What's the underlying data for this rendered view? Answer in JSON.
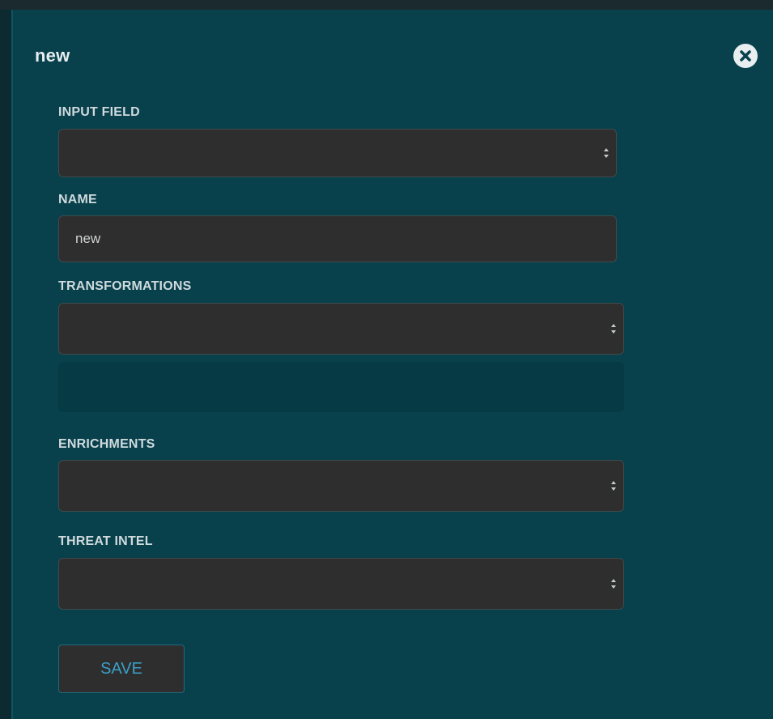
{
  "panel": {
    "title": "new",
    "close_icon": "close-circle-icon"
  },
  "form": {
    "input_field": {
      "label": "INPUT FIELD",
      "value": ""
    },
    "name": {
      "label": "NAME",
      "value": "new"
    },
    "transformations": {
      "label": "TRANSFORMATIONS",
      "value": ""
    },
    "enrichments": {
      "label": "ENRICHMENTS",
      "value": ""
    },
    "threat_intel": {
      "label": "THREAT INTEL",
      "value": ""
    }
  },
  "actions": {
    "save_label": "SAVE"
  },
  "colors": {
    "panel_bg": "#08404c",
    "field_bg": "#2e2e2e",
    "accent": "#3a9fc6"
  }
}
